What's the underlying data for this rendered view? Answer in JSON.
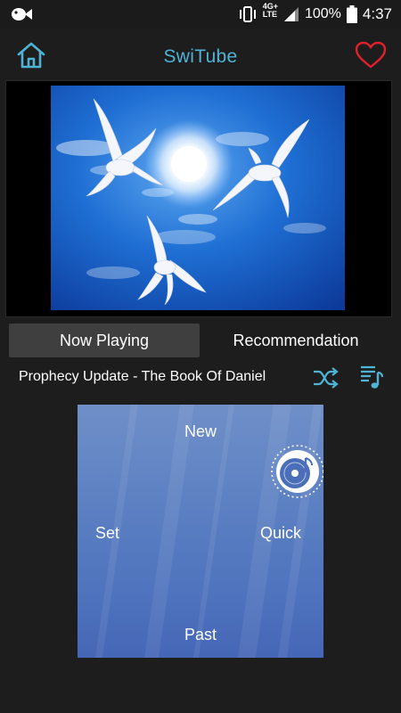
{
  "status_bar": {
    "network_badge_top": "4G+",
    "network_badge_bottom": "LTE",
    "battery_percent": "100%",
    "time": "4:37",
    "icons": [
      "app-fish-icon",
      "vibrate-icon",
      "signal-icon",
      "battery-icon"
    ]
  },
  "header": {
    "title": "SwiTube",
    "accent_color": "#4fb3d6",
    "favorite_color": "#e0202a"
  },
  "video": {
    "thumbnail": "white doves flying in blue sky with sun"
  },
  "tabs": [
    {
      "label": "Now Playing",
      "selected": true
    },
    {
      "label": "Recommendation",
      "selected": false
    }
  ],
  "now_playing": {
    "title": "Prophecy Update - The Book Of Daniel"
  },
  "panel": {
    "top_label": "New",
    "left_label": "Set",
    "right_label": "Quick",
    "bottom_label": "Past"
  }
}
